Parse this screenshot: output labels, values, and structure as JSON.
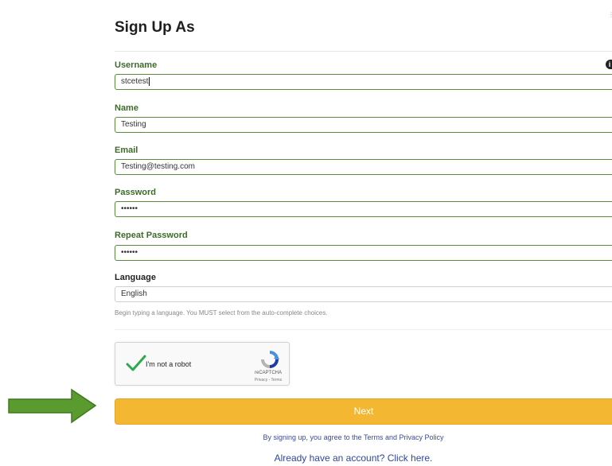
{
  "page": {
    "title": "Sign Up As"
  },
  "form": {
    "username": {
      "label": "Username",
      "value": "stcetest"
    },
    "name": {
      "label": "Name",
      "value": "Testing"
    },
    "email": {
      "label": "Email",
      "value": "Testing@testing.com"
    },
    "password": {
      "label": "Password",
      "value": "••••••"
    },
    "repeat_password": {
      "label": "Repeat Password",
      "value": "••••••"
    },
    "language": {
      "label": "Language",
      "value": "English",
      "help": "Begin typing a language. You MUST select from the auto-complete choices."
    }
  },
  "captcha": {
    "label": "I'm not a robot",
    "brand": "reCAPTCHA",
    "links": "Privacy - Terms"
  },
  "actions": {
    "next_label": "Next",
    "terms_text": "By signing up, you agree to the Terms and Privacy Policy",
    "login_text": "Already have an account? Click here."
  },
  "colors": {
    "accent_button": "#f4b732",
    "label_green": "#3d6b2a",
    "field_border": "#5a8a3a",
    "link_blue": "#2f47a0",
    "arrow_green": "#5a9a2e"
  },
  "icons": [
    "info-icon",
    "checkmark-icon",
    "recaptcha-logo-icon",
    "arrow-right-icon"
  ]
}
